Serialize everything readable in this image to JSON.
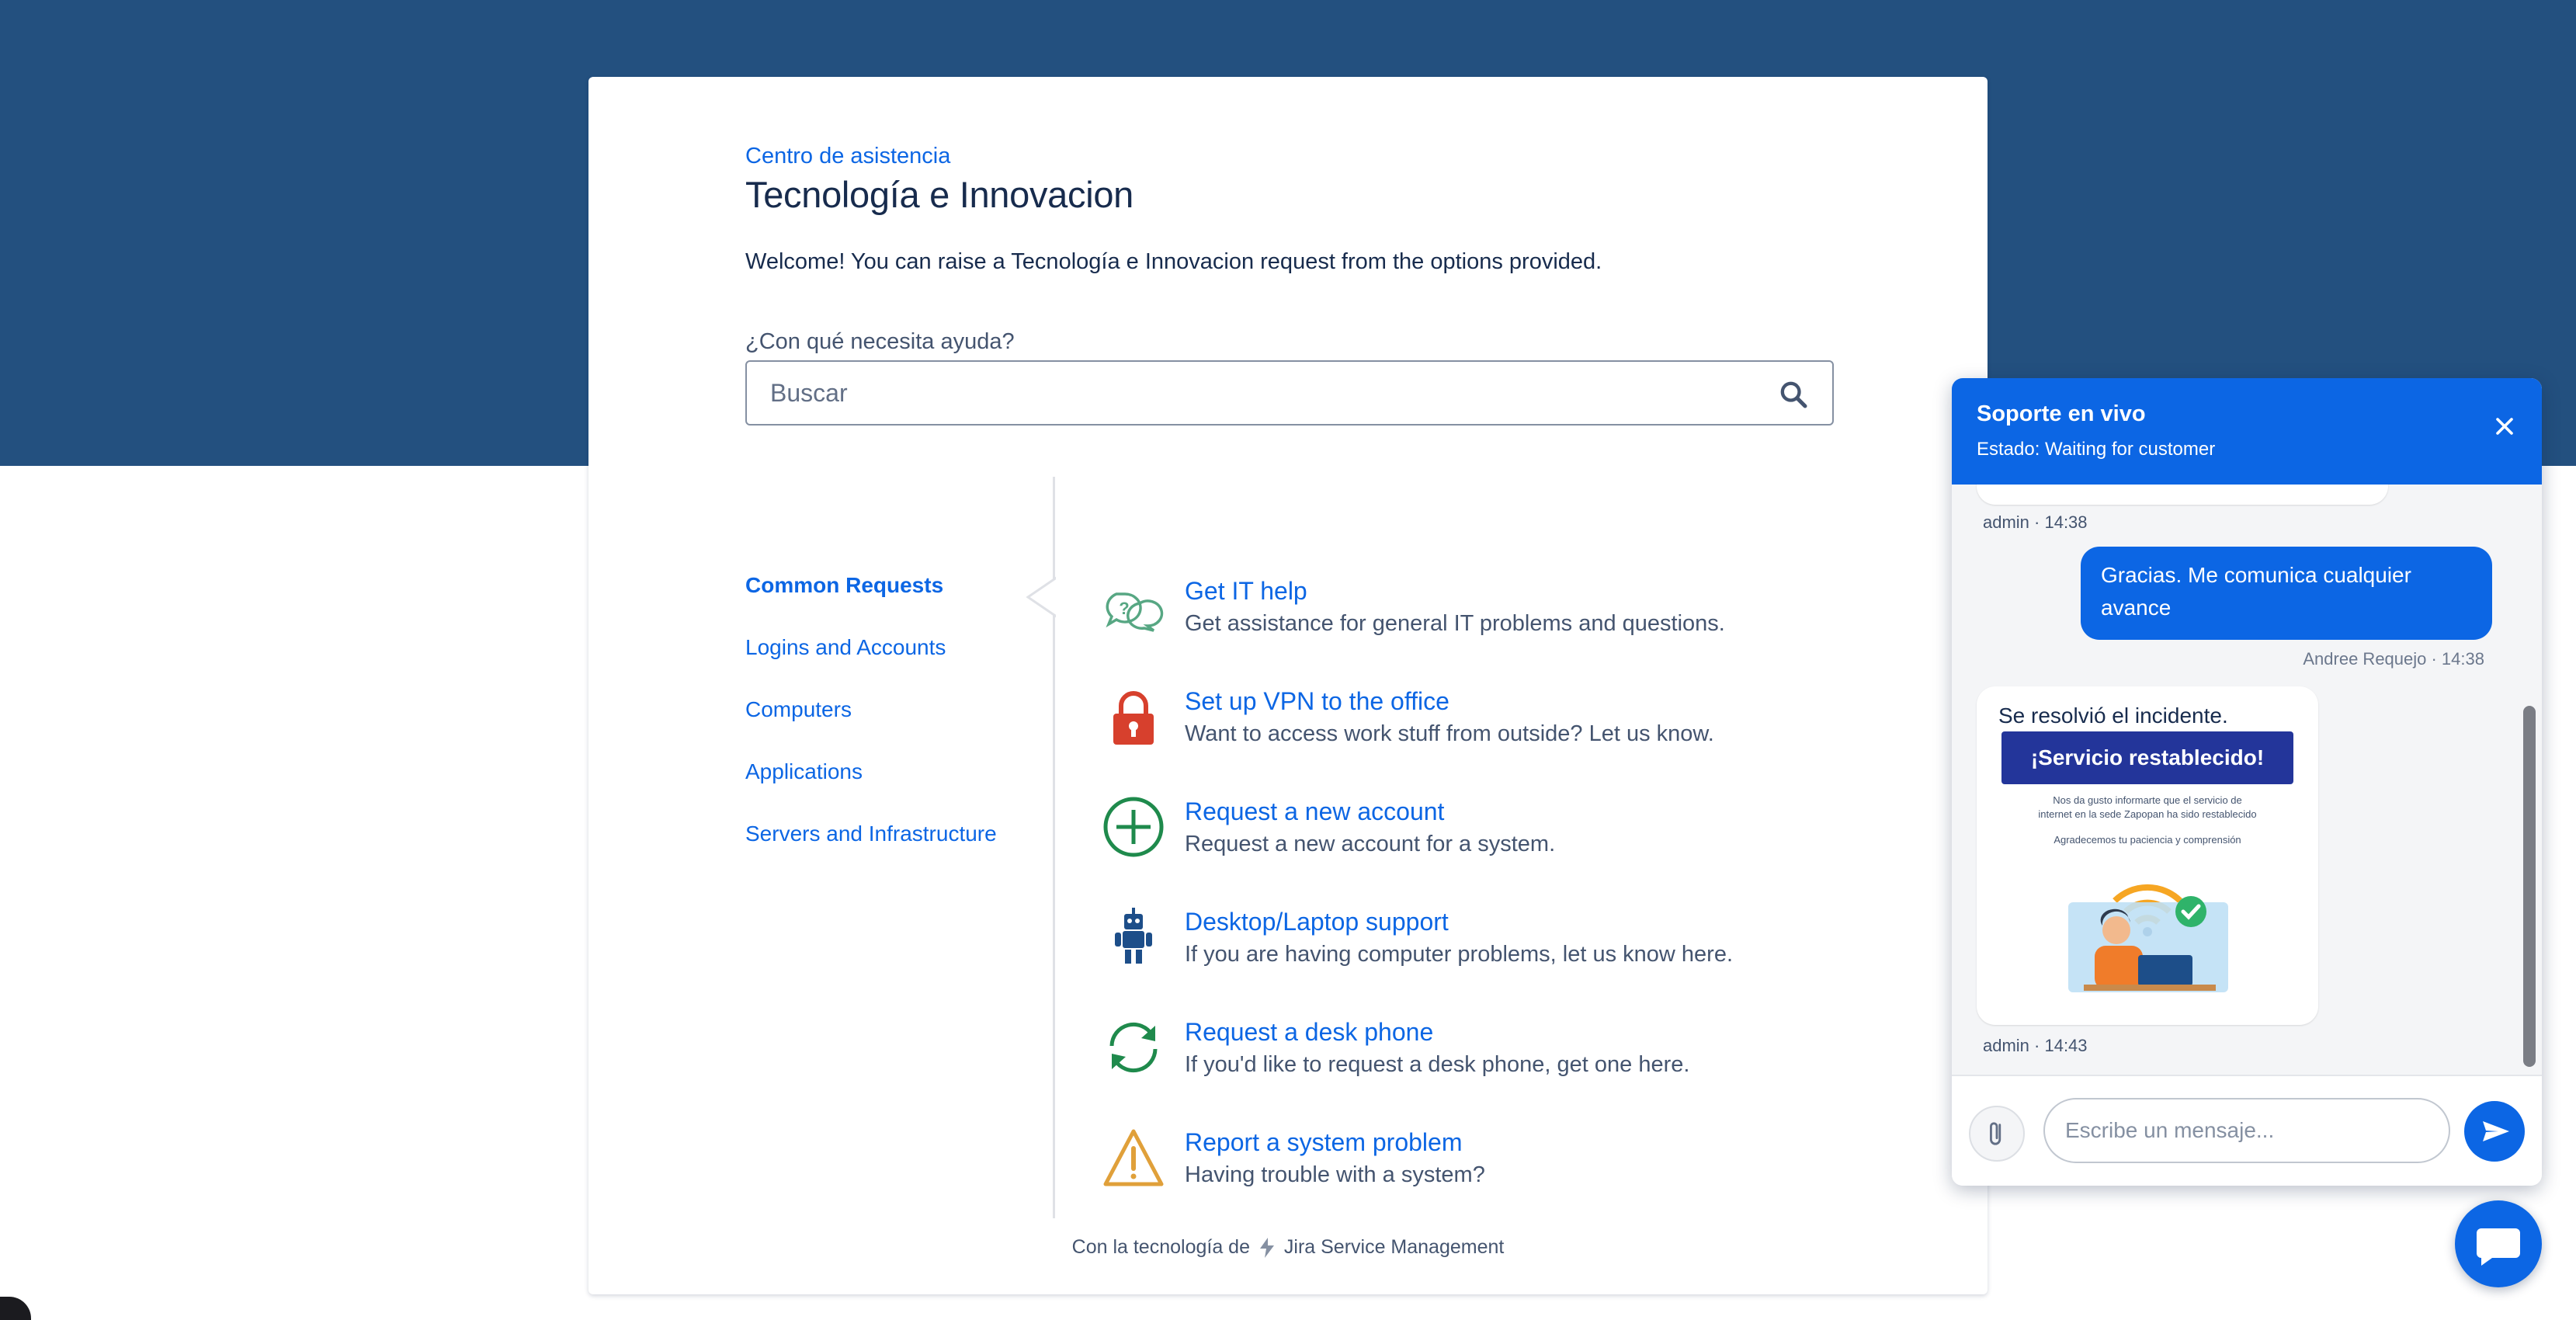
{
  "portal": {
    "breadcrumb": "Centro de asistencia",
    "title": "Tecnología e Innovacion",
    "welcome": "Welcome! You can raise a Tecnología e Innovacion request from the options provided."
  },
  "search": {
    "label": "¿Con qué necesita ayuda?",
    "placeholder": "Buscar",
    "icon": "search-icon"
  },
  "nav": {
    "items": [
      {
        "label": "Common Requests",
        "active": true
      },
      {
        "label": "Logins and Accounts"
      },
      {
        "label": "Computers"
      },
      {
        "label": "Applications"
      },
      {
        "label": "Servers and Infrastructure"
      }
    ]
  },
  "requests": [
    {
      "title": "Get IT help",
      "desc": "Get assistance for general IT problems and questions.",
      "icon": "chat-bubbles-icon",
      "color": "#57a783"
    },
    {
      "title": "Set up VPN to the office",
      "desc": "Want to access work stuff from outside? Let us know.",
      "icon": "lock-icon",
      "color": "#d7402d"
    },
    {
      "title": "Request a new account",
      "desc": "Request a new account for a system.",
      "icon": "plus-circle-icon",
      "color": "#1f8a4c"
    },
    {
      "title": "Desktop/Laptop support",
      "desc": "If you are having computer problems, let us know here.",
      "icon": "robot-icon",
      "color": "#1d4e89"
    },
    {
      "title": "Request a desk phone",
      "desc": "If you'd like to request a desk phone, get one here.",
      "icon": "refresh-icon",
      "color": "#1f8a4c"
    },
    {
      "title": "Report a system problem",
      "desc": "Having trouble with a system?",
      "icon": "warning-icon",
      "color": "#e0a03a"
    }
  ],
  "footer": {
    "prefix": "Con la tecnología de",
    "product": "Jira Service Management"
  },
  "chat": {
    "title": "Soporte en vivo",
    "status": "Estado: Waiting for customer",
    "messages": [
      {
        "meta": "admin · 14:38"
      },
      {
        "text": "Gracias. Me comunica cualquier avance",
        "meta": "Andree Requejo · 14:38"
      },
      {
        "text": "Se resolvió el incidente.",
        "meta": "admin · 14:43"
      }
    ],
    "banner": {
      "title": "¡Servicio restablecido!",
      "line1": "Nos da gusto informarte que el servicio de",
      "line2": "internet en la sede Zapopan ha sido restablecido",
      "line3": "Agradecemos tu paciencia y comprensión"
    },
    "input_placeholder": "Escribe un mensaje..."
  },
  "colors": {
    "brand": "#23507f",
    "link": "#0c66e4",
    "chat_header": "#0c66e4"
  }
}
